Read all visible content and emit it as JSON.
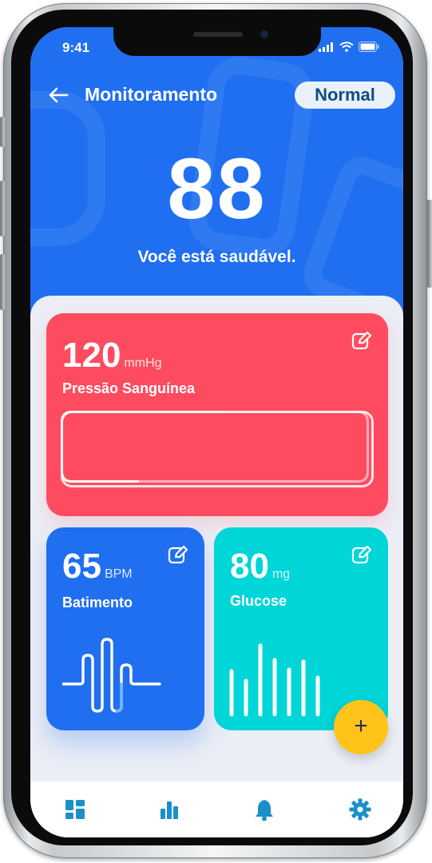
{
  "status_bar": {
    "time": "9:41"
  },
  "header": {
    "title": "Monitoramento",
    "status_badge": "Normal",
    "score": "88",
    "message": "Você está saudável."
  },
  "cards": {
    "blood_pressure": {
      "value": "120",
      "unit": "mmHg",
      "label": "Pressão Sanguínea"
    },
    "heart_rate": {
      "value": "65",
      "unit": "BPM",
      "label": "Batimento"
    },
    "glucose": {
      "value": "80",
      "unit": "mg",
      "label": "Glucose"
    }
  },
  "fab": {
    "label": "+"
  },
  "nav": {
    "items": [
      "dashboard-icon",
      "chart-icon",
      "bell-icon",
      "gear-icon"
    ],
    "active_color": "#1a8fc9"
  },
  "colors": {
    "primary": "#1f6ff0",
    "blood_pressure": "#ff4b5f",
    "glucose": "#00d5d8",
    "fab": "#ffc41a"
  }
}
